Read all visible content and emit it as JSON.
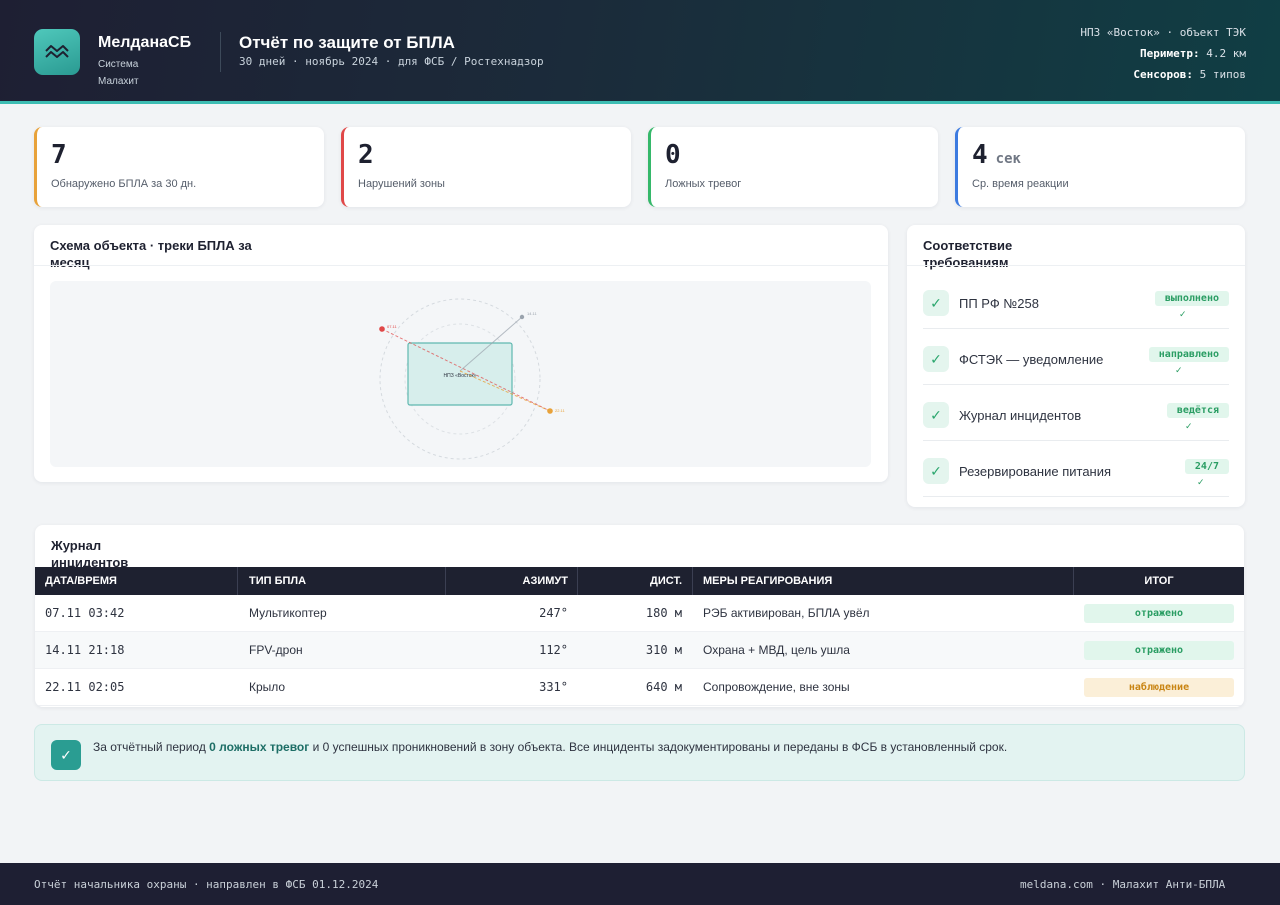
{
  "header": {
    "brand_name": "МелданаСБ",
    "brand_sub": "Система Малахит",
    "title": "Отчёт по защите от БПЛА",
    "subtitle": "30 дней · ноябрь 2024 · для ФСБ / Ростехнадзор",
    "site": "НПЗ «Восток» · объект ТЭК",
    "perimeter_label": "Периметр:",
    "perimeter_value": "4.2 км",
    "sensors_label": "Сенсоров:",
    "sensors_value": "5 типов"
  },
  "kpis": [
    {
      "value": "7",
      "unit": "",
      "label": "Обнаружено БПЛА за 30 дн.",
      "color": "#e8a23a"
    },
    {
      "value": "2",
      "unit": "",
      "label": "Нарушений зоны",
      "color": "#e04848"
    },
    {
      "value": "0",
      "unit": "",
      "label": "Ложных тревог",
      "color": "#35b86a"
    },
    {
      "value": "4",
      "unit": "сек",
      "label": "Ср. время реакции",
      "color": "#3d7be0"
    }
  ],
  "map": {
    "title": "Схема объекта · треки БПЛА за месяц",
    "facility_label": "НПЗ «Восток»",
    "tracks": [
      {
        "label": "07.11",
        "color": "#e04848"
      },
      {
        "label": "14.11",
        "color": "#9aa3ad"
      },
      {
        "label": "22.11",
        "color": "#e8a23a"
      }
    ]
  },
  "compliance": {
    "title": "Соответствие требованиям",
    "items": [
      {
        "label": "ПП РФ №258",
        "status": "выполнено"
      },
      {
        "label": "ФСТЭК — уведомление",
        "status": "направлено"
      },
      {
        "label": "Журнал инцидентов",
        "status": "ведётся"
      },
      {
        "label": "Резервирование питания",
        "status": "24/7"
      }
    ],
    "tick": "✓"
  },
  "incidents": {
    "title": "Журнал инцидентов",
    "columns": {
      "datetime": "ДАТА/ВРЕМЯ",
      "type": "ТИП БПЛА",
      "azimuth": "АЗИМУТ",
      "distance": "ДИСТ.",
      "actions": "МЕРЫ РЕАГИРОВАНИЯ",
      "result": "ИТОГ"
    },
    "rows": [
      {
        "datetime": "07.11 03:42",
        "type": "Мультикоптер",
        "azimuth": "247°",
        "distance": "180 м",
        "actions": "РЭБ активирован, БПЛА увёл",
        "result": "отражено"
      },
      {
        "datetime": "14.11 21:18",
        "type": "FPV-дрон",
        "azimuth": "112°",
        "distance": "310 м",
        "actions": "Охрана + МВД, цель ушла",
        "result": "отражено"
      },
      {
        "datetime": "22.11 02:05",
        "type": "Крыло",
        "azimuth": "331°",
        "distance": "640 м",
        "actions": "Сопровождение, вне зоны",
        "result": "наблюдение"
      }
    ]
  },
  "summary": {
    "text_1": "За отчётный период ",
    "bold": "0 ложных тревог",
    "text_2": " и 0 успешных проникновений в зону объекта. Все инциденты задокументированы и переданы в ФСБ в установленный срок."
  },
  "footer": {
    "left": "Отчёт начальника охраны · направлен в ФСБ 01.12.2024",
    "right": "meldana.com · Малахит Анти-БПЛА"
  }
}
